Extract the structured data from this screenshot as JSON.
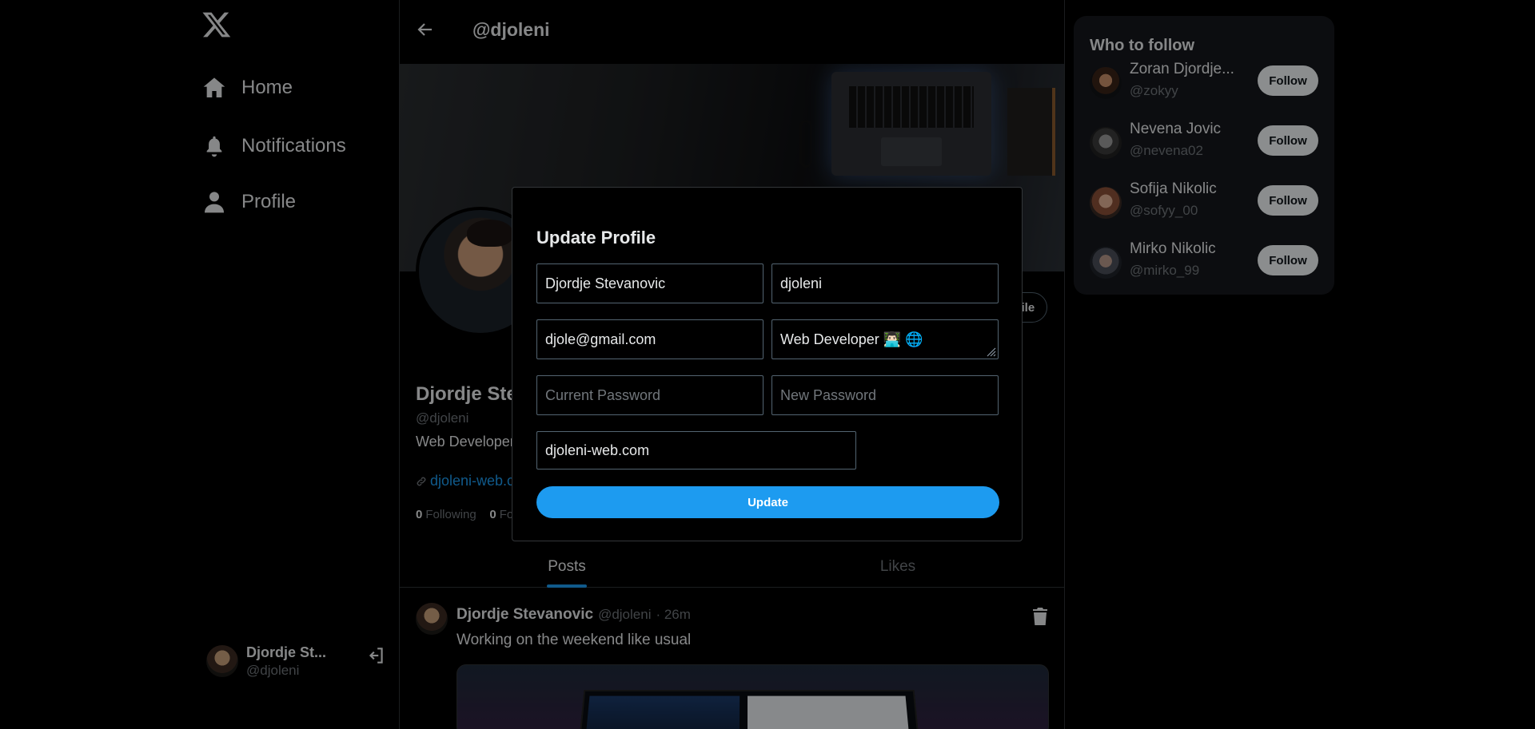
{
  "sidebar": {
    "nav": [
      {
        "label": "Home",
        "icon": "home-icon"
      },
      {
        "label": "Notifications",
        "icon": "bell-icon"
      },
      {
        "label": "Profile",
        "icon": "person-icon"
      }
    ],
    "user": {
      "name": "Djordje St...",
      "handle": "@djoleni"
    }
  },
  "header": {
    "handle": "@djoleni"
  },
  "profile": {
    "name": "Djordje Stevanovic",
    "handle": "@djoleni",
    "bio": "Web Developer",
    "link": "djoleni-web.com",
    "following_count": "0",
    "following_label": "Following",
    "followers_count": "0",
    "followers_label": "Followers",
    "edit_label": "Edit profile"
  },
  "tabs": [
    {
      "label": "Posts",
      "active": true
    },
    {
      "label": "Likes",
      "active": false
    }
  ],
  "post": {
    "author": "Djordje Stevanovic",
    "handle": "@djoleni",
    "time": "· 26m",
    "text": "Working on the weekend like usual"
  },
  "who_to_follow": {
    "title": "Who to follow",
    "follow_label": "Follow",
    "items": [
      {
        "name": "Zoran Djordje...",
        "handle": "@zokyy"
      },
      {
        "name": "Nevena Jovic",
        "handle": "@nevena02"
      },
      {
        "name": "Sofija Nikolic",
        "handle": "@sofyy_00"
      },
      {
        "name": "Mirko Nikolic",
        "handle": "@mirko_99"
      }
    ]
  },
  "modal": {
    "title": "Update Profile",
    "fields": {
      "name": "Djordje Stevanovic",
      "username": "djoleni",
      "email": "djole@gmail.com",
      "bio": "Web Developer 👨🏻‍💻 🌐",
      "current_password_placeholder": "Current Password",
      "new_password_placeholder": "New Password",
      "website": "djoleni-web.com"
    },
    "submit_label": "Update"
  },
  "colors": {
    "accent": "#1d9bf0",
    "background": "#000000",
    "panel": "#16181c",
    "border": "#2f3336",
    "muted": "#71767b"
  }
}
